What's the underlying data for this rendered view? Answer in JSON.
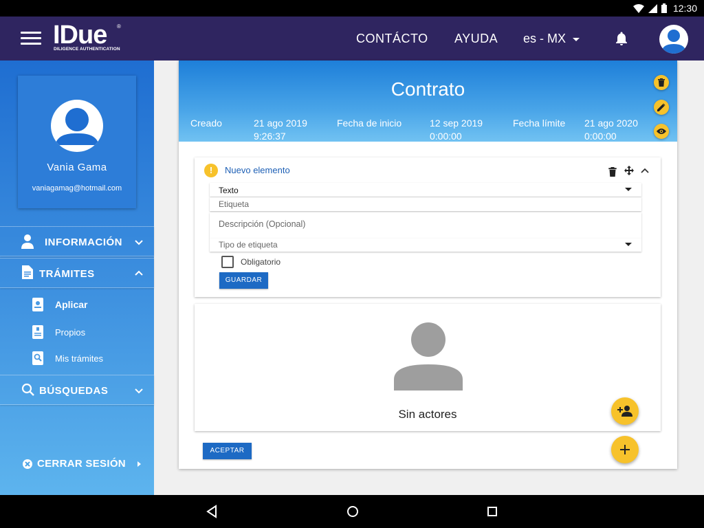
{
  "status_bar": {
    "time": "12:30"
  },
  "app_bar": {
    "logo_text": "IDue",
    "logo_registered": "®",
    "logo_tagline": "DILIGENCE AUTHENTICATION",
    "nav_contact": "CONTÁCTO",
    "nav_help": "AYUDA",
    "language": "es - MX"
  },
  "sidebar": {
    "user_name": "Vania Gama",
    "user_email": "vaniagamag@hotmail.com",
    "section_info": "INFORMACIÓN",
    "section_tramites": "TRÁMITES",
    "tramites_items": [
      "Aplicar",
      "Propios",
      "Mis trámites"
    ],
    "section_busquedas": "BÚSQUEDAS",
    "logout": "CERRAR SESIÓN"
  },
  "contract": {
    "title": "Contrato",
    "created_label": "Creado",
    "created_date": "21 ago 2019",
    "created_time": "9:26:37",
    "start_label": "Fecha de inicio",
    "start_date": "12 sep 2019",
    "start_time": "0:00:00",
    "deadline_label": "Fecha límite",
    "deadline_date": "21 ago 2020",
    "deadline_time": "0:00:00"
  },
  "new_element": {
    "title": "Nuevo elemento",
    "type_value": "Texto",
    "label_placeholder": "Etiqueta",
    "description_placeholder": "Descripción (Opcional)",
    "label_type_placeholder": "Tipo de etiqueta",
    "required_label": "Obligatorio",
    "required_checked": false,
    "save_button": "GUARDAR"
  },
  "actors": {
    "empty_text": "Sin actores"
  },
  "footer": {
    "accept_button": "ACEPTAR"
  },
  "colors": {
    "app_bar": "#2f2560",
    "sidebar_top": "#1f6ed1",
    "sidebar_bottom": "#5db4ee",
    "accent_yellow": "#f7c22b",
    "button_blue": "#1d6ac4"
  },
  "icons": {
    "status": [
      "wifi-icon",
      "cellular-signal-icon",
      "battery-icon"
    ],
    "header_actions": [
      "delete-icon",
      "edit-icon",
      "visibility-icon"
    ],
    "element_controls": [
      "delete-icon",
      "move-icon",
      "chevron-up-icon"
    ],
    "fabs": [
      "add-person-icon",
      "plus-icon"
    ],
    "nav": [
      "back-icon",
      "home-icon",
      "recents-icon"
    ]
  }
}
